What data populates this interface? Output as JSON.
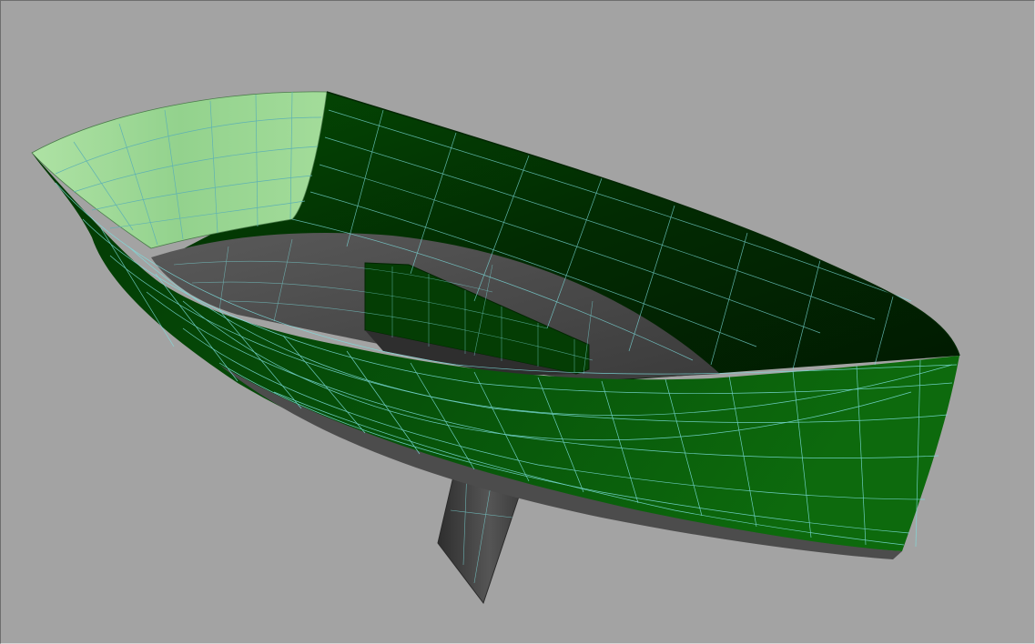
{
  "viewport": {
    "background": "#a3a3a3",
    "view": "3d-perspective"
  },
  "model": {
    "kind": "boat-hull-wireframe",
    "parts": [
      "hull-shell",
      "transom",
      "deck-floor",
      "cockpit-well",
      "keel-fin"
    ],
    "colors": {
      "hull_outer": "#0a4f0a",
      "hull_dark": "#022502",
      "transom": "#9fd89b",
      "deck": "#4b4b4b",
      "keel": "#4a4a4a",
      "wire": "#7ee0e0"
    }
  }
}
